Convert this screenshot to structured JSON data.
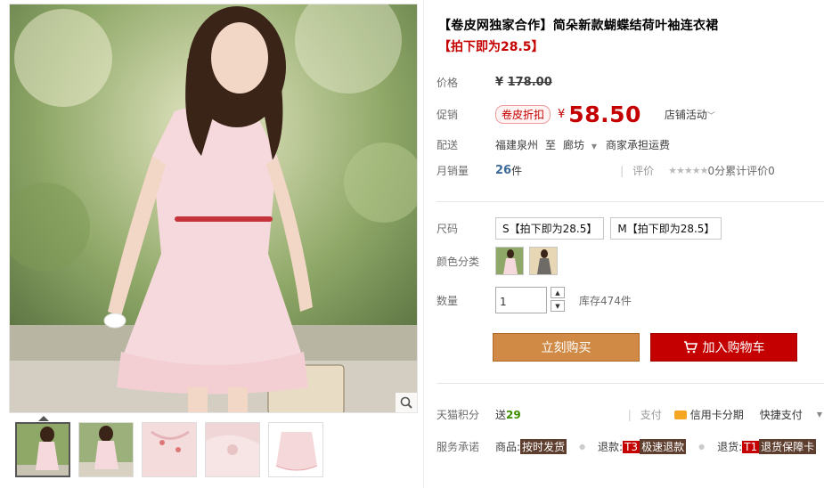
{
  "product": {
    "title": "【卷皮网独家合作】简朵新款蝴蝶结荷叶袖连衣裙",
    "subtitle": "【拍下即为28.5】"
  },
  "price": {
    "label": "价格",
    "original_prefix": "¥",
    "original": "178.00"
  },
  "promo": {
    "label": "促销",
    "tag": "卷皮折扣",
    "currency": "¥",
    "price": "58.50",
    "shop_activity": "店铺活动"
  },
  "shipping": {
    "label": "配送",
    "from": "福建泉州",
    "to_word": "至",
    "to": "廊坊",
    "fee": "商家承担运费"
  },
  "sales": {
    "label": "月销量",
    "count": "26",
    "unit": "件",
    "rating_label": "评价",
    "stars": "★★★★★",
    "rating_text": "0分累计评价0"
  },
  "size": {
    "label": "尺码",
    "options": [
      "S【拍下即为28.5】",
      "M【拍下即为28.5】"
    ]
  },
  "color": {
    "label": "颜色分类"
  },
  "quantity": {
    "label": "数量",
    "value": "1",
    "stock": "库存474件"
  },
  "actions": {
    "buy_now": "立刻购买",
    "add_cart": "加入购物车"
  },
  "points": {
    "label": "天猫积分",
    "prefix": "送",
    "value": "29",
    "pay_label": "支付",
    "credit": "信用卡分期",
    "quick_pay": "快捷支付"
  },
  "service": {
    "label": "服务承诺",
    "goods_label": "商品:",
    "goods_badge": "按时发货",
    "refund_label": "退款:",
    "refund_mark": "T3",
    "refund_badge": "极速退款",
    "return_label": "退货:",
    "return_mark": "T1",
    "return_badge": "退货保障卡"
  },
  "colors": {
    "accent_red": "#c40000",
    "buy_orange": "#d08a46"
  },
  "icons": [
    "zoom-icon",
    "chevron-down-icon",
    "cart-icon",
    "credit-card-icon",
    "star-icon"
  ]
}
